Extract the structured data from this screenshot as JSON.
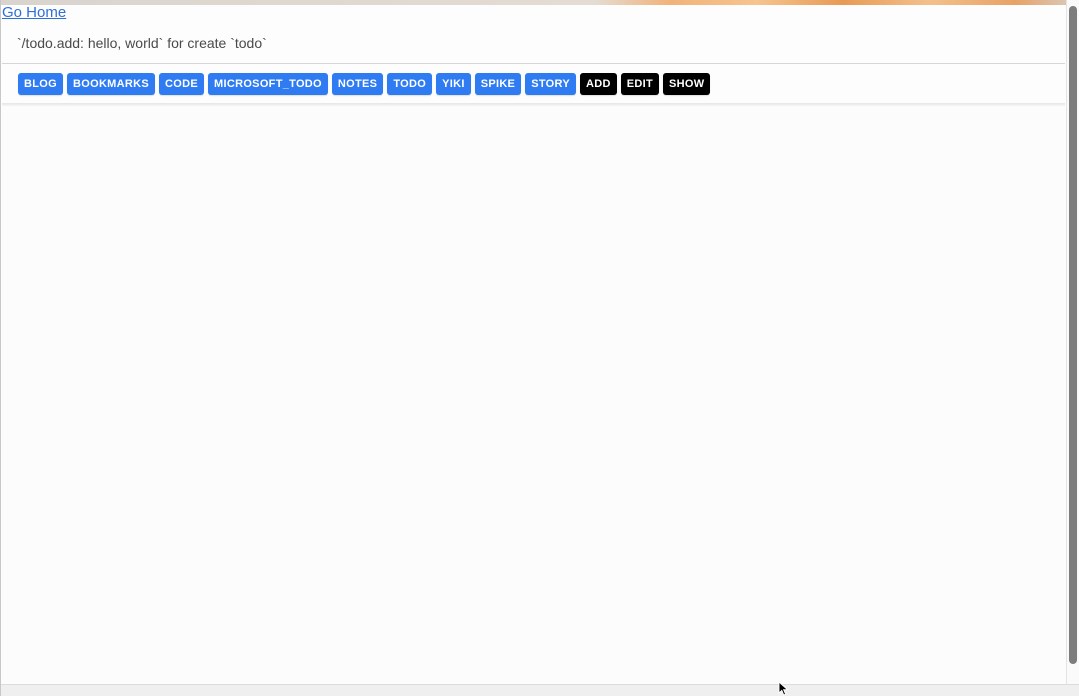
{
  "header": {
    "go_home_label": "Go Home",
    "hint_text": "`/todo.add: hello, world` for create `todo`"
  },
  "toolbar": {
    "category_buttons": [
      {
        "label": "BLOG"
      },
      {
        "label": "BOOKMARKS"
      },
      {
        "label": "CODE"
      },
      {
        "label": "MICROSOFT_TODO"
      },
      {
        "label": "NOTES"
      },
      {
        "label": "TODO"
      },
      {
        "label": "YIKI"
      },
      {
        "label": "SPIKE"
      },
      {
        "label": "STORY"
      }
    ],
    "action_buttons": [
      {
        "label": "ADD"
      },
      {
        "label": "EDIT"
      },
      {
        "label": "SHOW"
      }
    ]
  },
  "colors": {
    "link": "#2f6fd8",
    "category_button_bg": "#2f7bf2",
    "action_button_bg": "#000000",
    "button_text": "#ffffff"
  },
  "icons": {
    "cursor": "mouse-pointer-icon"
  }
}
